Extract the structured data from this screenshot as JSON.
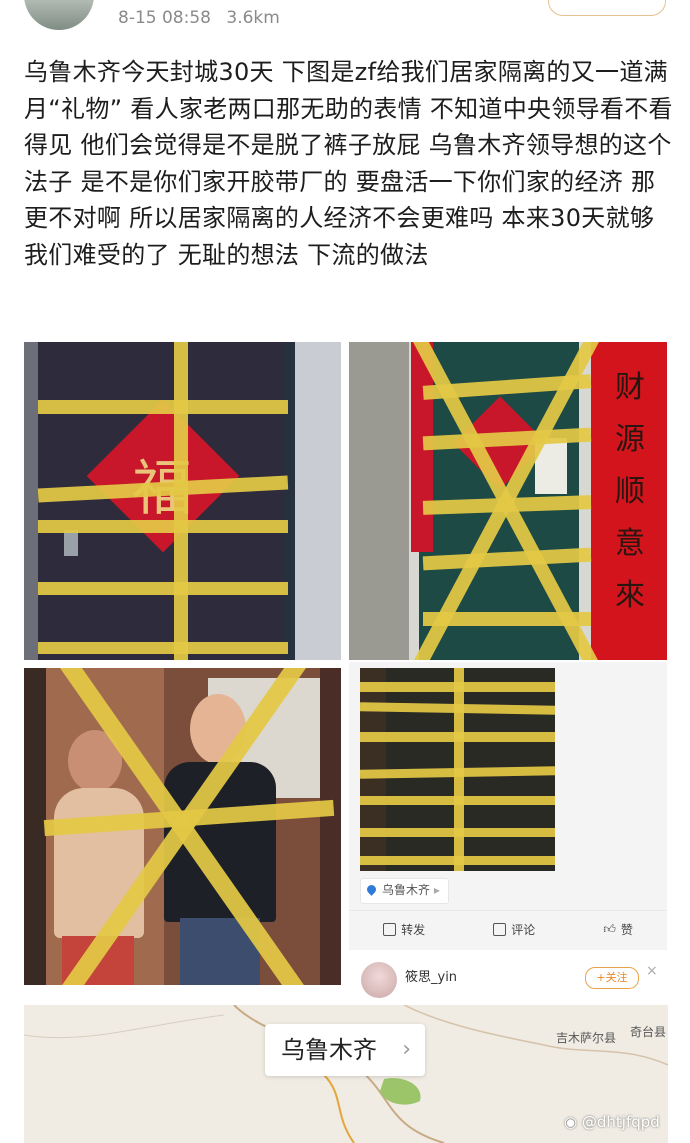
{
  "header": {
    "time": "8-15 08:58",
    "distance": "3.6km"
  },
  "post": {
    "text": "乌鲁木齐今天封城30天   下图是zf给我们居家隔离的又一道满月“礼物”  看人家老两口那无助的表情  不知道中央领导看不看得见  他们会觉得是不是脱了裤子放屁  乌鲁木齐领导想的这个法子  是不是你们家开胶带厂的  要盘活一下你们家的经济  那更不对啊  所以居家隔离的人经济不会更难吗  本来30天就够我们难受的了  无耻的想法  下流的做法"
  },
  "photos": {
    "door1_char": "福",
    "couplet_text": "财源顺意來"
  },
  "card": {
    "location": "乌鲁木齐",
    "actions": {
      "repost": "转发",
      "comment": "评论",
      "like": "赞"
    },
    "user": {
      "name": "筱思_yin",
      "follow": "+关注",
      "close": "×"
    }
  },
  "map": {
    "label": "乌鲁木齐",
    "county1": "吉木萨尔县",
    "county2": "奇台县",
    "watermark": "@dhtjfqpd"
  },
  "colors": {
    "tape": "#e3c845",
    "fu_red": "#c8162a",
    "couplet_red": "#d3141d",
    "follow_orange": "#e8892a"
  },
  "icons": [
    "location-pin-icon",
    "repost-icon",
    "comment-icon",
    "like-icon",
    "chevron-right-icon",
    "close-icon",
    "weibo-icon"
  ]
}
